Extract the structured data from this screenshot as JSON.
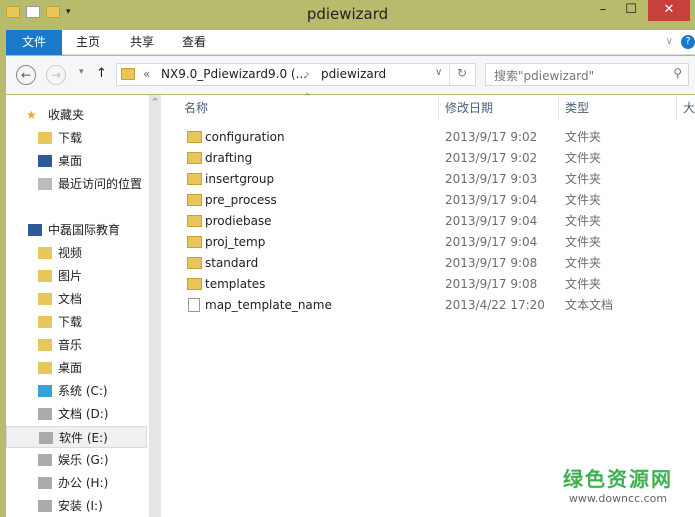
{
  "window": {
    "title": "pdiewizard",
    "minimize": "–",
    "maximize": "☐",
    "close": "✕"
  },
  "ribbon": {
    "tabs": [
      "文件",
      "主页",
      "共享",
      "查看"
    ],
    "help": "?",
    "expand": "∨"
  },
  "address": {
    "back": "←",
    "forward": "→",
    "up": "↑",
    "recent": "▾",
    "path_prefix": "«",
    "crumb1": "NX9.0_Pdiewizard9.0 (...",
    "sep": "›",
    "crumb2": "pdiewizard",
    "dropdown": "∨",
    "refresh": "↻",
    "search_placeholder": "搜索\"pdiewizard\"",
    "search_icon": "⚲"
  },
  "sidebar": {
    "favorites": {
      "label": "收藏夹",
      "items": [
        "下载",
        "桌面",
        "最近访问的位置"
      ]
    },
    "computer": {
      "label": "中磊国际教育",
      "items": [
        "视频",
        "图片",
        "文档",
        "下载",
        "音乐",
        "桌面",
        "系统 (C:)",
        "文档 (D:)",
        "软件 (E:)",
        "娱乐 (G:)",
        "办公 (H:)",
        "安装 (I:)"
      ]
    }
  },
  "columns": {
    "name": "名称",
    "date": "修改日期",
    "type": "类型",
    "size": "大"
  },
  "files": [
    {
      "name": "configuration",
      "date": "2013/9/17 9:02",
      "type": "文件夹",
      "kind": "folder"
    },
    {
      "name": "drafting",
      "date": "2013/9/17 9:02",
      "type": "文件夹",
      "kind": "folder"
    },
    {
      "name": "insertgroup",
      "date": "2013/9/17 9:03",
      "type": "文件夹",
      "kind": "folder"
    },
    {
      "name": "pre_process",
      "date": "2013/9/17 9:04",
      "type": "文件夹",
      "kind": "folder"
    },
    {
      "name": "prodiebase",
      "date": "2013/9/17 9:04",
      "type": "文件夹",
      "kind": "folder"
    },
    {
      "name": "proj_temp",
      "date": "2013/9/17 9:04",
      "type": "文件夹",
      "kind": "folder"
    },
    {
      "name": "standard",
      "date": "2013/9/17 9:08",
      "type": "文件夹",
      "kind": "folder"
    },
    {
      "name": "templates",
      "date": "2013/9/17 9:08",
      "type": "文件夹",
      "kind": "folder"
    },
    {
      "name": "map_template_name",
      "date": "2013/4/22 17:20",
      "type": "文本文档",
      "kind": "text"
    }
  ],
  "watermark": {
    "line1": "绿色资源网",
    "line2": "www.downcc.com"
  }
}
